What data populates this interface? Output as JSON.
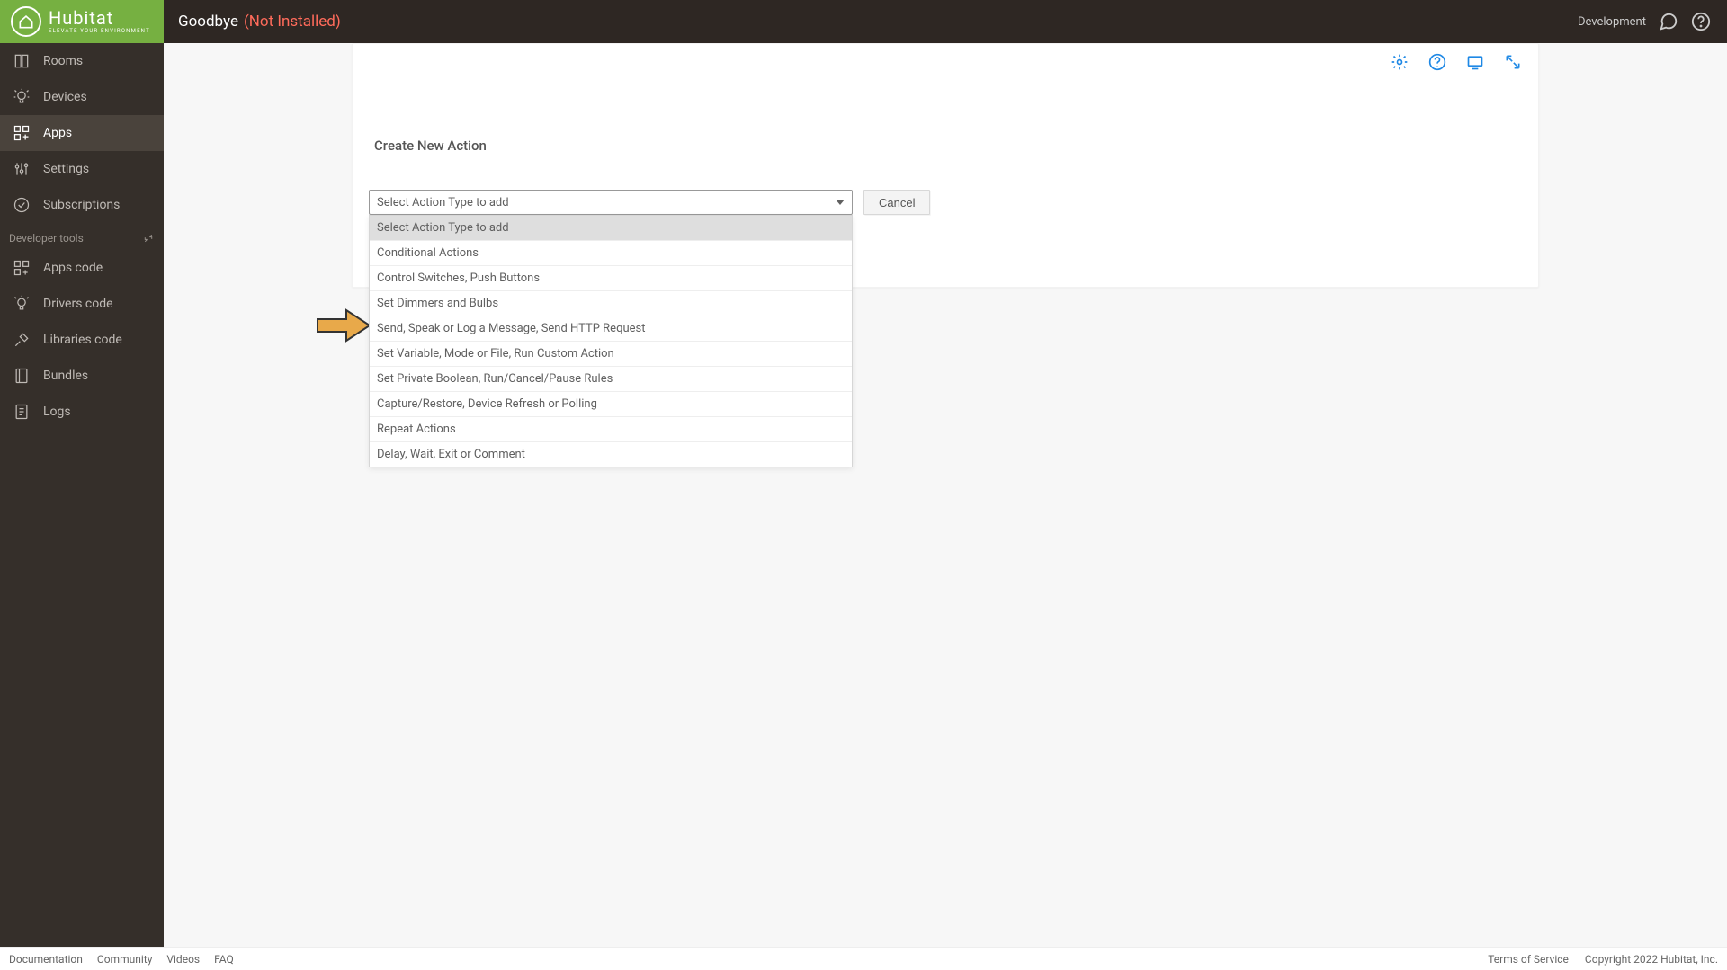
{
  "logo": {
    "word": "Hubitat",
    "sub": "ELEVATE YOUR ENVIRONMENT"
  },
  "page": {
    "title": "Goodbye",
    "status": "(Not Installed)"
  },
  "topbar": {
    "env": "Development"
  },
  "sidebar": {
    "items": [
      {
        "label": "Rooms"
      },
      {
        "label": "Devices"
      },
      {
        "label": "Apps"
      },
      {
        "label": "Settings"
      },
      {
        "label": "Subscriptions"
      }
    ],
    "dev_header": "Developer tools",
    "dev_items": [
      {
        "label": "Apps code"
      },
      {
        "label": "Drivers code"
      },
      {
        "label": "Libraries code"
      },
      {
        "label": "Bundles"
      },
      {
        "label": "Logs"
      }
    ]
  },
  "main": {
    "heading": "Create New Action",
    "select_placeholder": "Select Action Type to add",
    "options": [
      "Select Action Type to add",
      "Conditional Actions",
      "Control Switches, Push Buttons",
      "Set Dimmers and Bulbs",
      "Send, Speak or Log a Message, Send HTTP Request",
      "Set Variable, Mode or File, Run Custom Action",
      "Set Private Boolean, Run/Cancel/Pause Rules",
      "Capture/Restore, Device Refresh or Polling",
      "Repeat Actions",
      "Delay, Wait, Exit or Comment"
    ],
    "cancel": "Cancel"
  },
  "footer": {
    "links": [
      "Documentation",
      "Community",
      "Videos",
      "FAQ"
    ],
    "terms": "Terms of Service",
    "copyright": "Copyright 2022 Hubitat, Inc."
  }
}
